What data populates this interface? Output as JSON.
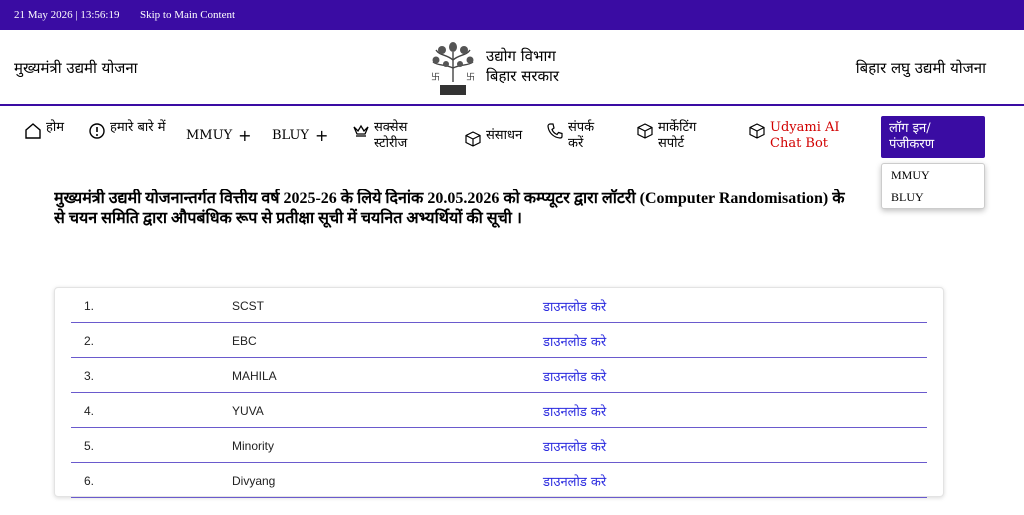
{
  "topbar": {
    "datetime": "21 May 2026 | 13:56:19",
    "skip_link": "Skip to Main Content"
  },
  "header": {
    "left_title": "मुख्यमंत्री उद्यमी योजना",
    "dept_line1": "उद्योग विभाग",
    "dept_line2": "बिहार सरकार",
    "right_title": "बिहार लघु उद्यमी योजना"
  },
  "nav": {
    "home": "होम",
    "about": "हमारे बारे में",
    "mmuy": "MMUY",
    "bluy": "BLUY",
    "success": "सक्सेस स्टोरीज",
    "resources": "संसाधन",
    "contact": "संपर्क करें",
    "marketing": "मार्केटिंग सपोर्ट",
    "ai_chat": "Udyami AI Chat Bot",
    "login": "लॉग इन/ पंजीकरण",
    "plus_symbol": "+"
  },
  "dropdown": {
    "options": [
      "MMUY",
      "BLUY"
    ]
  },
  "heading": {
    "line1": "मुख्यमंत्री उद्यमी योजनान्तर्गत वित्तीय वर्ष 2025-26 के लिये दिनांक 20.05.2026 को कम्प्यूटर द्वारा लॉटरी (Computer Randomisation) के",
    "line2": "से चयन समिति द्वारा औपबंधिक रूप से प्रतीक्षा सूची में चयनित अभ्यर्थियों की सूची ।"
  },
  "table": {
    "rows": [
      {
        "num": "1.",
        "category": "SCST",
        "link": "डाउनलोड करे"
      },
      {
        "num": "2.",
        "category": "EBC",
        "link": "डाउनलोड करे"
      },
      {
        "num": "3.",
        "category": "MAHILA",
        "link": "डाउनलोड करे"
      },
      {
        "num": "4.",
        "category": "YUVA",
        "link": "डाउनलोड करे"
      },
      {
        "num": "5.",
        "category": "Minority",
        "link": "डाउनलोड करे"
      },
      {
        "num": "6.",
        "category": "Divyang",
        "link": "डाउनलोड करे"
      }
    ]
  },
  "colors": {
    "brand": "#3a0ca3",
    "link": "#2a2adf",
    "ai_text": "#d10000"
  },
  "icons": {
    "home": "home-icon",
    "about": "info-icon",
    "success": "crown-icon",
    "resources": "cube-icon",
    "contact": "phone-icon",
    "marketing": "cube-icon",
    "ai_chat": "cube-icon",
    "emblem": "bihar-emblem-icon"
  }
}
